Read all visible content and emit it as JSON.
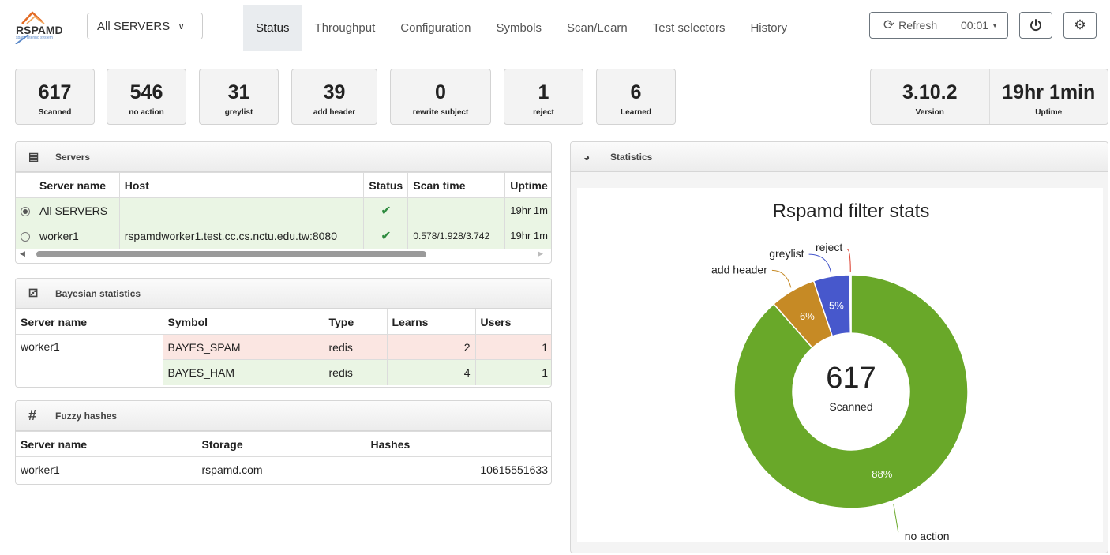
{
  "brand": {
    "name": "RSPAMD",
    "subtitle": "spam filtering system"
  },
  "server_selector": {
    "value": "All SERVERS"
  },
  "tabs": [
    {
      "label": "Status"
    },
    {
      "label": "Throughput"
    },
    {
      "label": "Configuration"
    },
    {
      "label": "Symbols"
    },
    {
      "label": "Scan/Learn"
    },
    {
      "label": "Test selectors"
    },
    {
      "label": "History"
    }
  ],
  "active_tab": "Status",
  "toolbar": {
    "refresh_label": "Refresh",
    "interval": "00:01"
  },
  "stats": [
    {
      "value": "617",
      "label": "Scanned"
    },
    {
      "value": "546",
      "label": "no action"
    },
    {
      "value": "31",
      "label": "greylist"
    },
    {
      "value": "39",
      "label": "add header"
    },
    {
      "value": "0",
      "label": "rewrite subject"
    },
    {
      "value": "1",
      "label": "reject"
    },
    {
      "value": "6",
      "label": "Learned"
    }
  ],
  "version": {
    "value": "3.10.2",
    "label": "Version"
  },
  "uptime": {
    "value": "19hr 1min",
    "label": "Uptime"
  },
  "servers": {
    "title": "Servers",
    "columns": [
      "Server name",
      "Host",
      "Status",
      "Scan time",
      "Uptime"
    ],
    "rows": [
      {
        "name": "All SERVERS",
        "host": "",
        "scan_time": "",
        "uptime": "19hr 1m"
      },
      {
        "name": "worker1",
        "host": "rspamdworker1.test.cc.cs.nctu.edu.tw:8080",
        "scan_time": "0.578/1.928/3.742",
        "uptime": "19hr 1m"
      }
    ]
  },
  "bayes": {
    "title": "Bayesian statistics",
    "columns": [
      "Server name",
      "Symbol",
      "Type",
      "Learns",
      "Users"
    ],
    "server": "worker1",
    "rows": [
      {
        "symbol": "BAYES_SPAM",
        "type": "redis",
        "learns": "2",
        "users": "1"
      },
      {
        "symbol": "BAYES_HAM",
        "type": "redis",
        "learns": "4",
        "users": "1"
      }
    ]
  },
  "fuzzy": {
    "title": "Fuzzy hashes",
    "columns": [
      "Server name",
      "Storage",
      "Hashes"
    ],
    "rows": [
      {
        "server": "worker1",
        "storage": "rspamd.com",
        "hashes": "10615551633"
      }
    ]
  },
  "statistics": {
    "title": "Statistics"
  },
  "chart_data": {
    "type": "pie",
    "title": "Rspamd filter stats",
    "center_value": "617",
    "center_label": "Scanned",
    "slices": [
      {
        "label": "no action",
        "value": 546,
        "pct_label": "88%",
        "color": "#69a829"
      },
      {
        "label": "add header",
        "value": 39,
        "pct_label": "6%",
        "color": "#c68a25"
      },
      {
        "label": "greylist",
        "value": 31,
        "pct_label": "5%",
        "color": "#4758cc"
      },
      {
        "label": "reject",
        "value": 1,
        "pct_label": "",
        "color": "#d9301f"
      }
    ]
  }
}
